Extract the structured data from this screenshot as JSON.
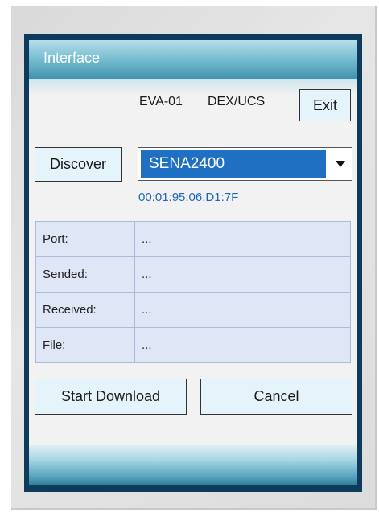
{
  "window": {
    "title": "Interface"
  },
  "header": {
    "model": "EVA-01",
    "protocol": "DEX/UCS",
    "exit_label": "Exit"
  },
  "discover": {
    "button_label": "Discover",
    "selected_device": "SENA2400",
    "mac_address": "00:01:95:06:D1:7F"
  },
  "status": {
    "rows": [
      {
        "label": "Port:",
        "value": "..."
      },
      {
        "label": "Sended:",
        "value": "..."
      },
      {
        "label": "Received:",
        "value": "..."
      },
      {
        "label": "File:",
        "value": "..."
      }
    ]
  },
  "actions": {
    "start_label": "Start Download",
    "cancel_label": "Cancel"
  },
  "colors": {
    "accent": "#1f6fc3",
    "frame": "#0e3a5c",
    "button_fill": "#e5f3fb"
  },
  "icons": {
    "dropdown": "triangle-down-icon"
  }
}
